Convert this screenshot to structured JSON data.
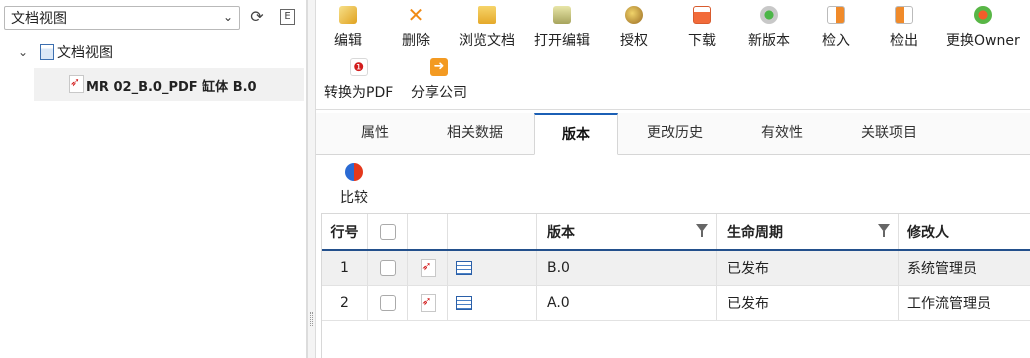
{
  "left_panel": {
    "view_select_value": "文档视图",
    "refresh_icon": "refresh-icon",
    "e_button": "E",
    "tree": {
      "root_label": "文档视图",
      "child_label": "MR      02_B.0_PDF 缸体 B.0"
    }
  },
  "toolbar": {
    "buttons": [
      {
        "label": "编辑",
        "icon": "edit-icon"
      },
      {
        "label": "删除",
        "icon": "delete-icon"
      },
      {
        "label": "浏览文档",
        "icon": "folder-open-icon"
      },
      {
        "label": "打开编辑",
        "icon": "open-edit-icon"
      },
      {
        "label": "授权",
        "icon": "authorize-icon"
      },
      {
        "label": "下载",
        "icon": "download-icon"
      },
      {
        "label": "新版本",
        "icon": "new-version-icon"
      },
      {
        "label": "检入",
        "icon": "check-in-icon"
      },
      {
        "label": "检出",
        "icon": "check-out-icon"
      },
      {
        "label": "更换Owner",
        "icon": "change-owner-icon"
      },
      {
        "label": "转换为PDF",
        "icon": "pdf-icon"
      },
      {
        "label": "分享公司",
        "icon": "share-icon"
      }
    ]
  },
  "tabs": [
    {
      "label": "属性"
    },
    {
      "label": "相关数据"
    },
    {
      "label": "版本",
      "active": true
    },
    {
      "label": "更改历史"
    },
    {
      "label": "有效性"
    },
    {
      "label": "关联项目"
    }
  ],
  "compare_label": "比较",
  "table": {
    "headers": {
      "no": "行号",
      "version": "版本",
      "lifecycle": "生命周期",
      "modifier": "修改人"
    },
    "rows": [
      {
        "no": "1",
        "version": "B.0",
        "lifecycle": "已发布",
        "modifier": "系统管理员"
      },
      {
        "no": "2",
        "version": "A.0",
        "lifecycle": "已发布",
        "modifier": "工作流管理员"
      }
    ]
  },
  "colors": {
    "accent": "#1b5fb5",
    "header_rule": "#23508c",
    "selected_row": "#f0f0f0"
  }
}
